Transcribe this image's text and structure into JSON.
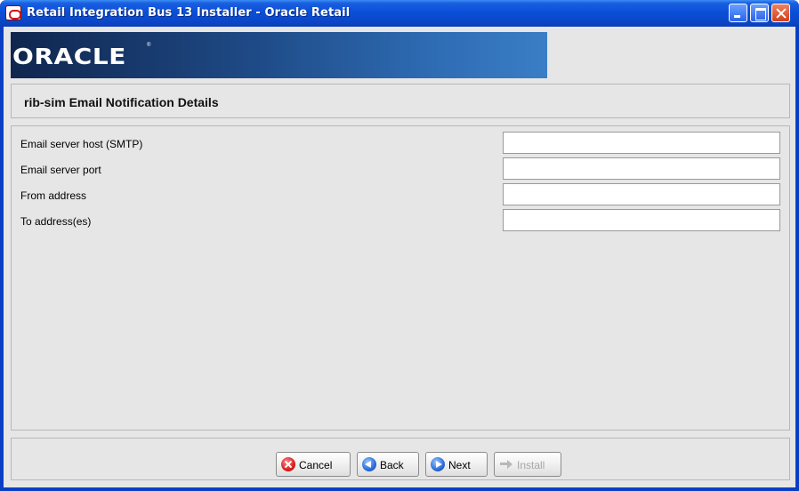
{
  "window": {
    "title": "Retail Integration Bus 13 Installer - Oracle Retail"
  },
  "banner": {
    "logo_text": "ORACLE",
    "registered_mark": "®"
  },
  "section": {
    "title": "rib-sim Email Notification Details"
  },
  "form": {
    "fields": [
      {
        "label": "Email server host (SMTP)",
        "value": ""
      },
      {
        "label": "Email server port",
        "value": ""
      },
      {
        "label": "From address",
        "value": ""
      },
      {
        "label": "To address(es)",
        "value": ""
      }
    ]
  },
  "buttons": {
    "cancel": "Cancel",
    "back": "Back",
    "next": "Next",
    "install": "Install"
  },
  "icons": {
    "app": "oracle-icon",
    "cancel": "cancel-icon",
    "back": "back-arrow-icon",
    "next": "next-arrow-icon",
    "install": "install-arrow-icon"
  },
  "colors": {
    "titlebar": "#0a4fd8",
    "banner": "#1e4a86",
    "panel": "#e6e6e6"
  }
}
